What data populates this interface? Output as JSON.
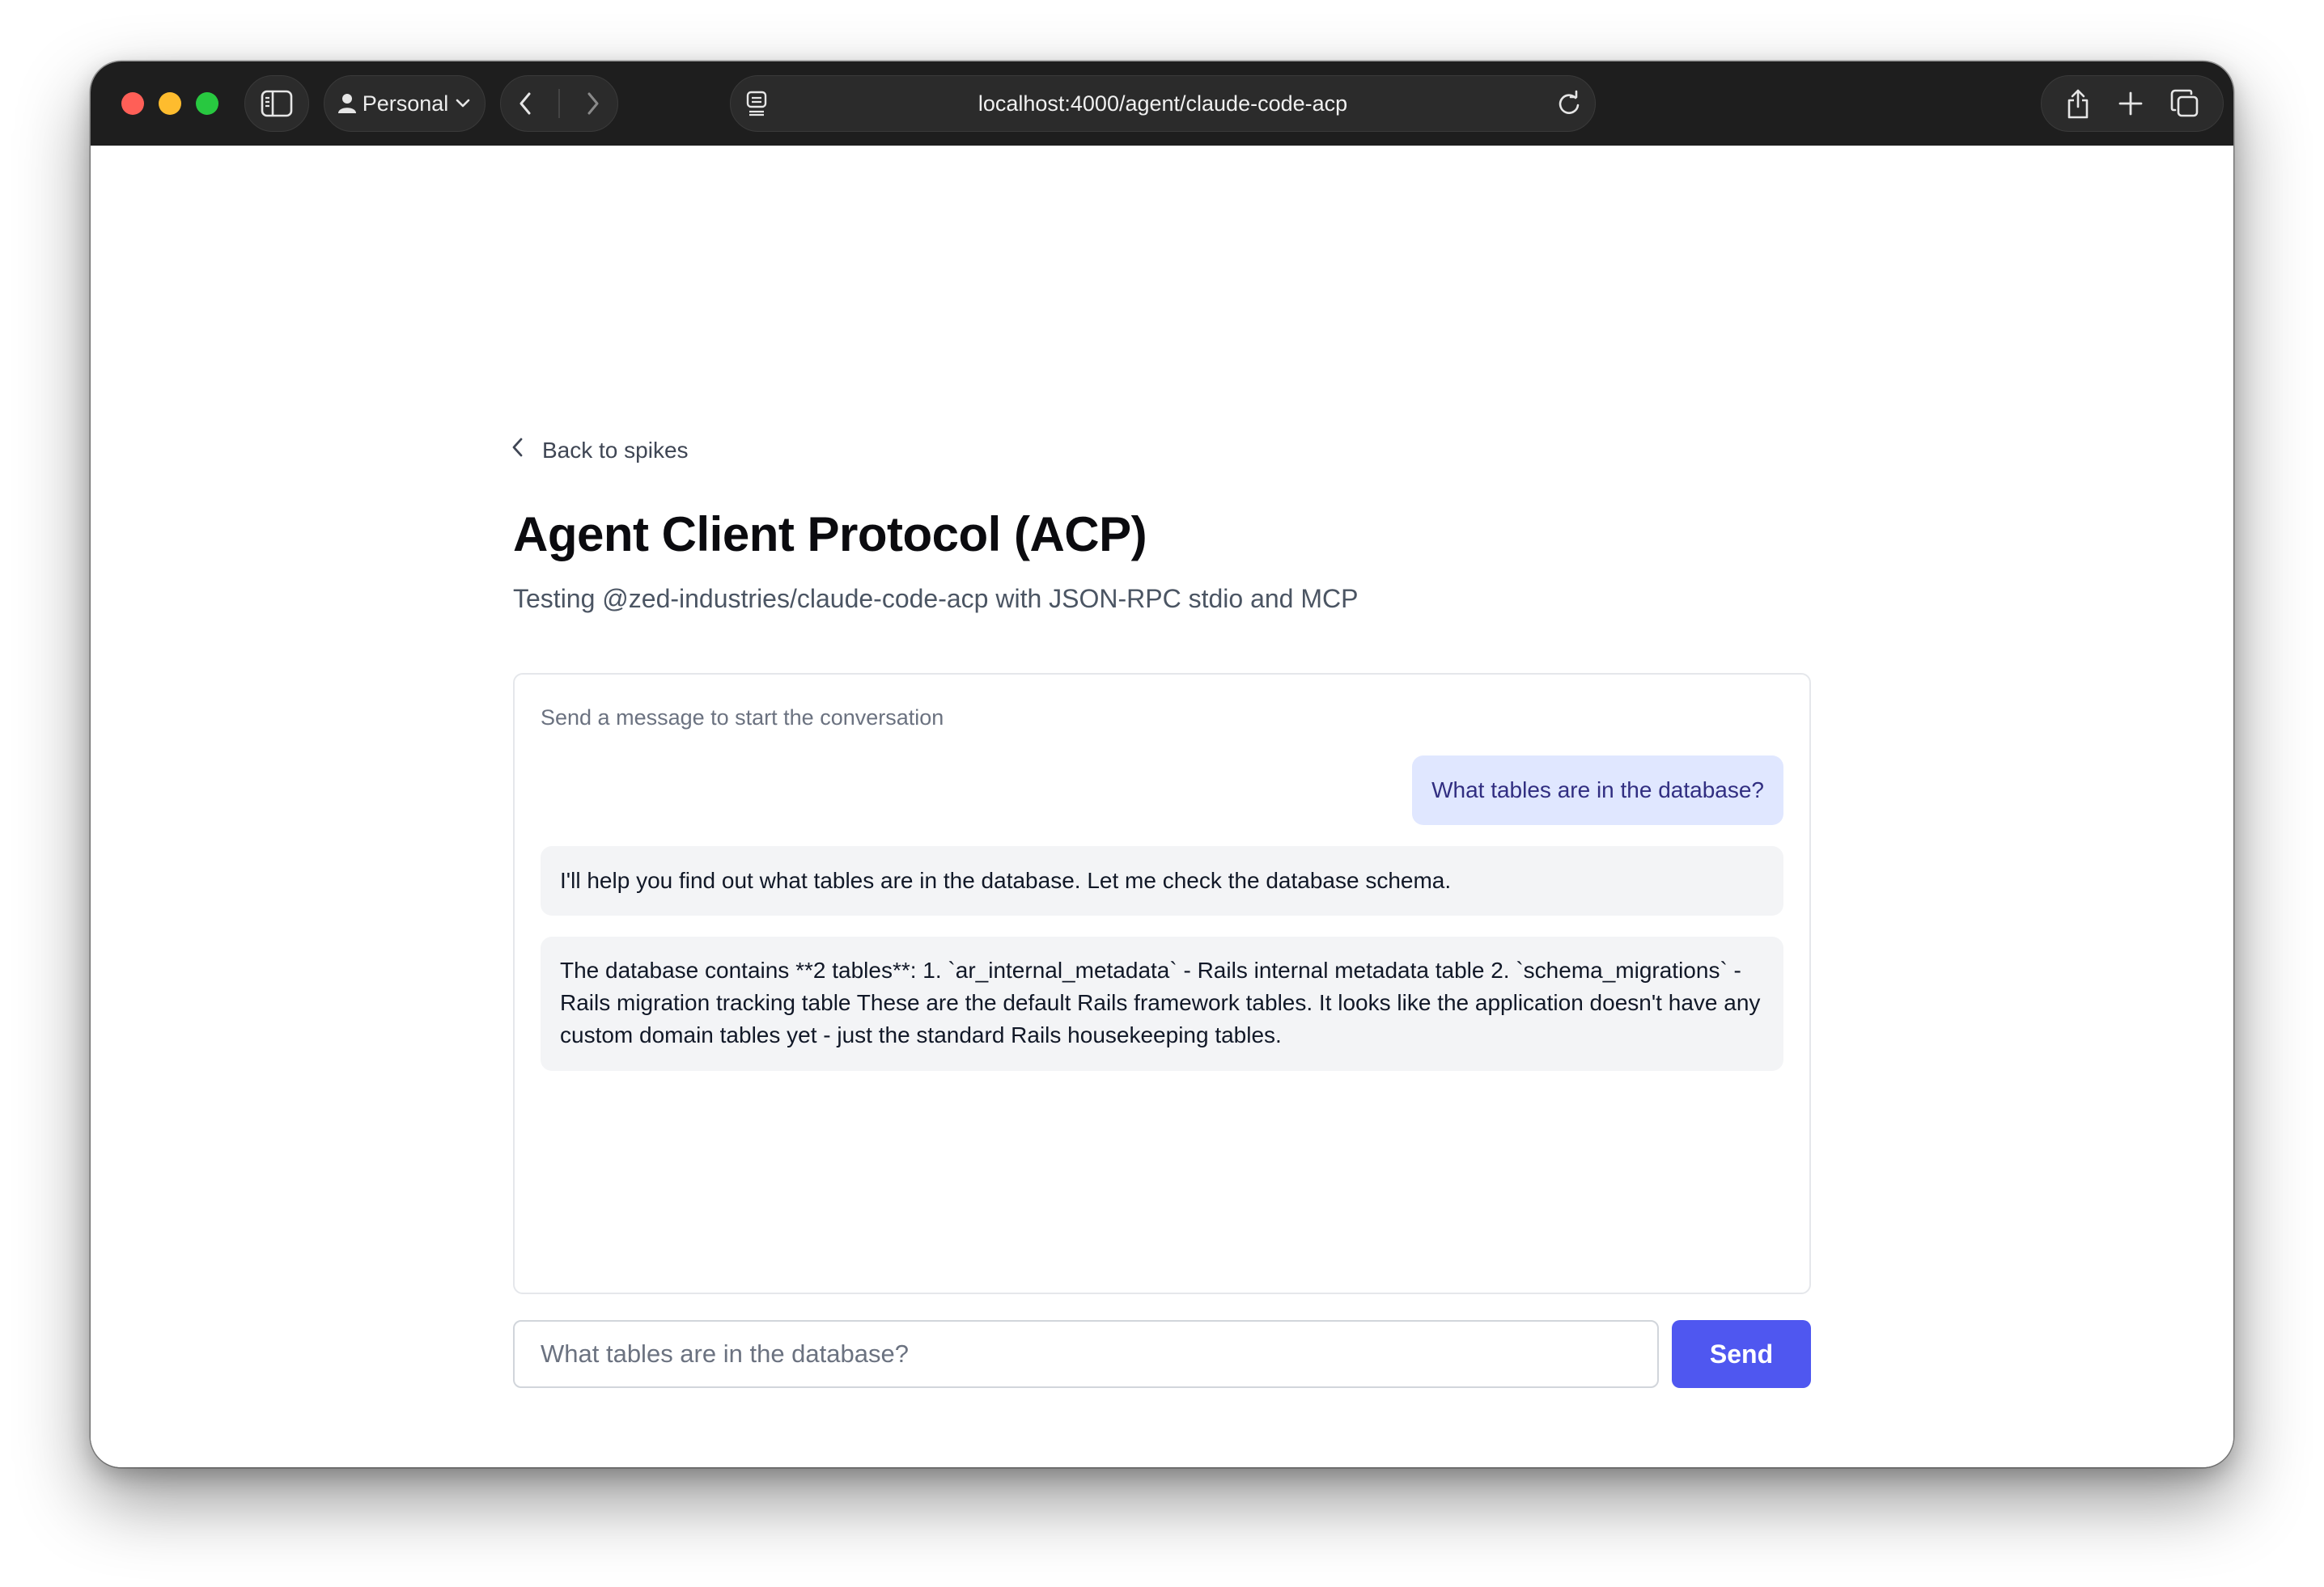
{
  "browser": {
    "profile_label": "Personal",
    "url": "localhost:4000/agent/claude-code-acp"
  },
  "page": {
    "back_link": "Back to spikes",
    "title": "Agent Client Protocol (ACP)",
    "subtitle": "Testing @zed-industries/claude-code-acp with JSON-RPC stdio and MCP"
  },
  "chat": {
    "empty_hint": "Send a message to start the conversation",
    "messages": [
      {
        "role": "user",
        "text": "What tables are in the database?"
      },
      {
        "role": "agent",
        "text": "I'll help you find out what tables are in the database. Let me check the database schema."
      },
      {
        "role": "agent",
        "text": "The database contains **2 tables**: 1. `ar_internal_metadata` - Rails internal metadata table 2. `schema_migrations` - Rails migration tracking table These are the default Rails framework tables. It looks like the application doesn't have any custom domain tables yet - just the standard Rails housekeeping tables."
      }
    ],
    "input_placeholder": "What tables are in the database?",
    "send_label": "Send"
  },
  "colors": {
    "accent": "#4f57f0",
    "user_bubble": "#e0e7ff",
    "agent_bubble": "#f3f4f6"
  },
  "icons": {
    "sidebar": "sidebar-toggle-icon",
    "profile": "person-icon",
    "back": "chevron-left-icon",
    "forward": "chevron-right-icon",
    "reader": "reader-mode-icon",
    "reload": "reload-icon",
    "share": "share-icon",
    "new_tab": "plus-icon",
    "tabs": "tab-overview-icon"
  }
}
